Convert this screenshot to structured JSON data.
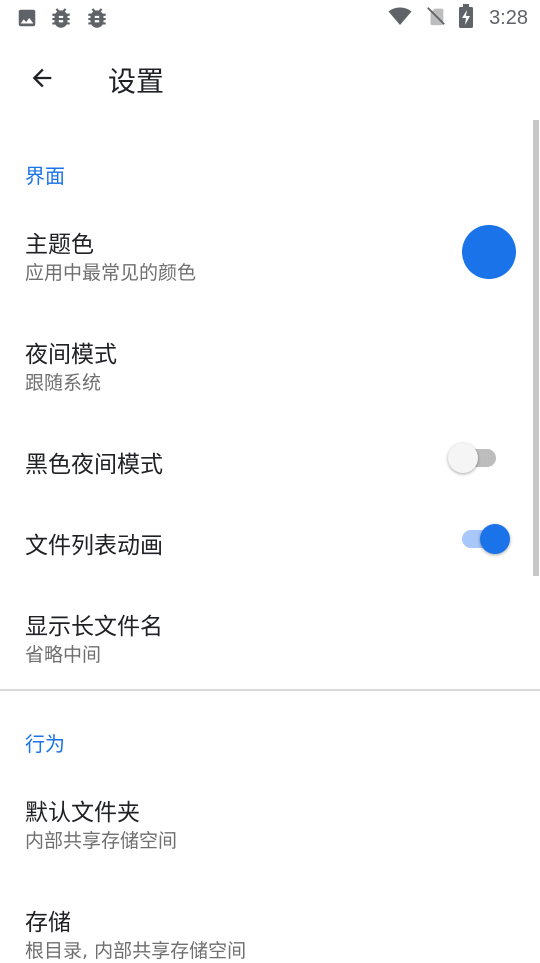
{
  "status_bar": {
    "time": "3:28",
    "left_icons": [
      "image-icon",
      "bug-icon",
      "bug-icon"
    ],
    "right_icons": [
      "wifi-icon",
      "no-sim-icon",
      "battery-charging-icon"
    ]
  },
  "toolbar": {
    "back_icon": "arrow-back-icon",
    "title": "设置"
  },
  "sections": {
    "interface": {
      "header": "界面",
      "theme_color": {
        "title": "主题色",
        "summary": "应用中最常见的颜色",
        "color": "#1a73e8"
      },
      "night_mode": {
        "title": "夜间模式",
        "summary": "跟随系统"
      },
      "black_night_mode": {
        "title": "黑色夜间模式",
        "checked": false
      },
      "file_list_animation": {
        "title": "文件列表动画",
        "checked": true
      },
      "show_long_file_name": {
        "title": "显示长文件名",
        "summary": "省略中间"
      }
    },
    "behavior": {
      "header": "行为",
      "default_folder": {
        "title": "默认文件夹",
        "summary": "内部共享存储空间"
      },
      "storage": {
        "title": "存储",
        "summary": "根目录, 内部共享存储空间"
      }
    }
  },
  "colors": {
    "accent": "#1a73e8",
    "switch_on_track": "#a8c7fa",
    "switch_off_track": "#bdbdbd",
    "switch_off_thumb": "#f5f5f5"
  }
}
